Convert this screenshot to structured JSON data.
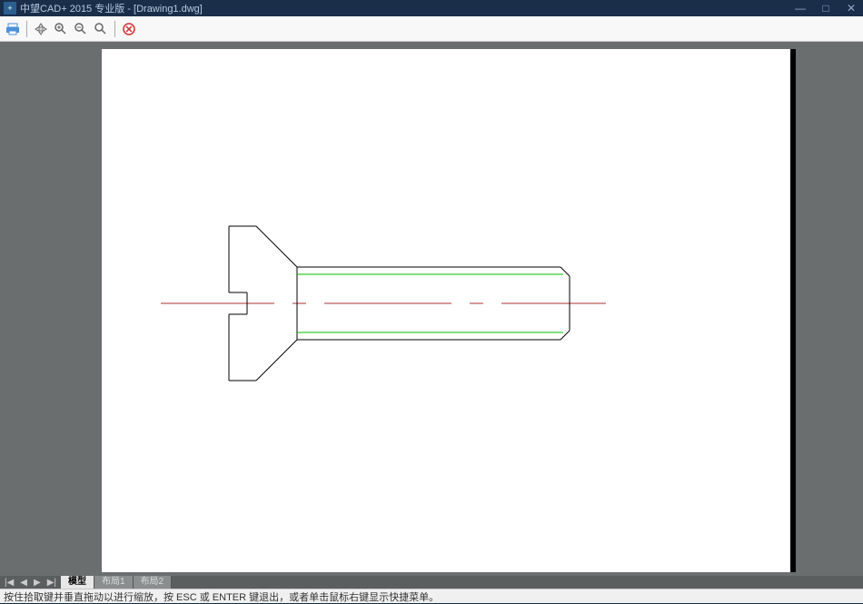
{
  "titlebar": {
    "app_name": "中望CAD+ 2015 专业版",
    "document_name": "[Drawing1.dwg]"
  },
  "tabs": {
    "active": "模型",
    "layout1": "布局1",
    "layout2": "布局2"
  },
  "statusbar": {
    "message": "按住拾取键并垂直拖动以进行缩放，按 ESC 或 ENTER 键退出，或者单击鼠标右键显示快捷菜单。"
  },
  "drawing": {
    "element_description": "沉头螺钉技术图样（countersunk screw）",
    "centerline_color": "#b03030",
    "thread_color": "#00c000",
    "outline_color": "#000000"
  }
}
